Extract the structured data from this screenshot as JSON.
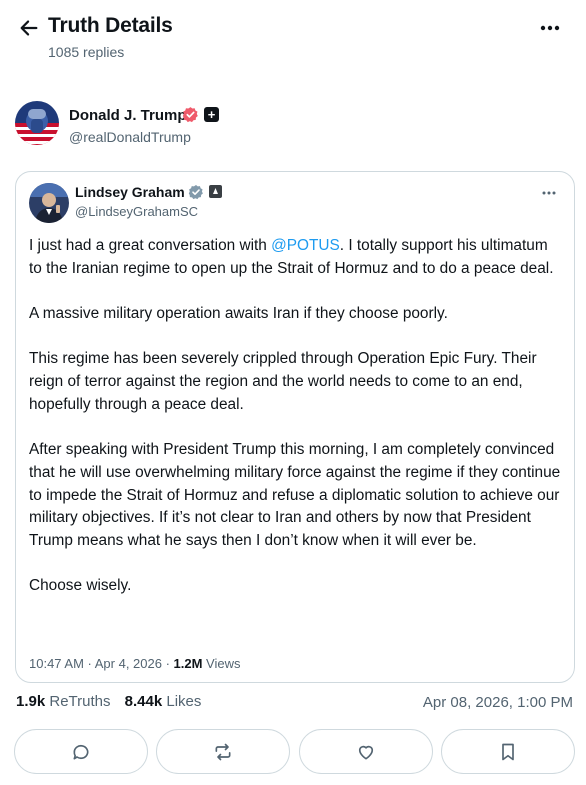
{
  "header": {
    "title": "Truth Details",
    "reply_count": "1085 replies"
  },
  "author": {
    "name": "Donald J. Trump",
    "handle": "@realDonaldTrump"
  },
  "quoted_post": {
    "name": "Lindsey Graham",
    "handle": "@LindseyGrahamSC",
    "p1_before": "I just had a great conversation with ",
    "mention": "@POTUS",
    "p1_after": ". I totally support his ultimatum to the Iranian regime to open up the Strait of Hormuz and to do a peace deal.",
    "p2": "A massive military operation awaits Iran if they choose poorly.",
    "p3": "This regime has been severely crippled through Operation Epic Fury. Their reign of terror against the region and the world needs to come to an end, hopefully through a peace deal.",
    "p4": "After speaking with President Trump this morning, I am completely convinced that he will use overwhelming military force against the regime if they continue to impede the Strait of Hormuz and refuse a diplomatic solution to achieve our military objectives. If it’s not clear to Iran and others by now that President Trump means what he says then I don’t know when it will ever be.",
    "p5": "Choose wisely.",
    "time": "10:47 AM · Apr 4, 2026 · ",
    "views_count": "1.2M",
    "views_label": " Views"
  },
  "stats": {
    "retruths_count": "1.9k",
    "retruths_label": " ReTruths",
    "likes_count": "8.44k",
    "likes_label": " Likes",
    "date": "Apr 08, 2026, 1:00 PM"
  },
  "icons": {
    "back": "arrow-left-icon",
    "more": "ellipsis-icon",
    "reply": "comment-icon",
    "retruth": "repost-icon",
    "like": "heart-icon",
    "bookmark": "bookmark-icon"
  },
  "colors": {
    "text": "#0f1419",
    "muted": "#536471",
    "link": "#1d9bf0",
    "border": "#cfd9de",
    "verified_badge": "#ef5b6b"
  }
}
